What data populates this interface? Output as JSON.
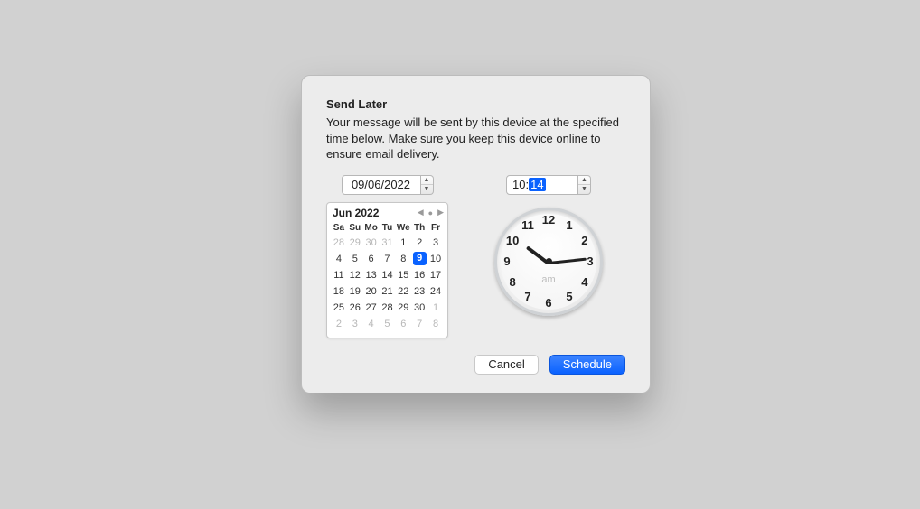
{
  "dialog": {
    "title": "Send Later",
    "description": "Your message will be sent by this device at the specified time below. Make sure you keep this device online to ensure email delivery.",
    "date_value": "09/06/2022",
    "time_hour": "10",
    "time_sep": ":",
    "time_min": "14",
    "calendar": {
      "month_label": "Jun 2022",
      "dow": [
        "Sa",
        "Su",
        "Mo",
        "Tu",
        "We",
        "Th",
        "Fr"
      ],
      "rows": [
        [
          {
            "v": "28",
            "dim": true
          },
          {
            "v": "29",
            "dim": true
          },
          {
            "v": "30",
            "dim": true
          },
          {
            "v": "31",
            "dim": true
          },
          {
            "v": "1"
          },
          {
            "v": "2"
          },
          {
            "v": "3"
          }
        ],
        [
          {
            "v": "4"
          },
          {
            "v": "5"
          },
          {
            "v": "6"
          },
          {
            "v": "7"
          },
          {
            "v": "8"
          },
          {
            "v": "9",
            "sel": true
          },
          {
            "v": "10"
          }
        ],
        [
          {
            "v": "11"
          },
          {
            "v": "12"
          },
          {
            "v": "13"
          },
          {
            "v": "14"
          },
          {
            "v": "15"
          },
          {
            "v": "16"
          },
          {
            "v": "17"
          }
        ],
        [
          {
            "v": "18"
          },
          {
            "v": "19"
          },
          {
            "v": "20"
          },
          {
            "v": "21"
          },
          {
            "v": "22"
          },
          {
            "v": "23"
          },
          {
            "v": "24"
          }
        ],
        [
          {
            "v": "25"
          },
          {
            "v": "26"
          },
          {
            "v": "27"
          },
          {
            "v": "28"
          },
          {
            "v": "29"
          },
          {
            "v": "30"
          },
          {
            "v": "1",
            "dim": true
          }
        ],
        [
          {
            "v": "2",
            "dim": true
          },
          {
            "v": "3",
            "dim": true
          },
          {
            "v": "4",
            "dim": true
          },
          {
            "v": "5",
            "dim": true
          },
          {
            "v": "6",
            "dim": true
          },
          {
            "v": "7",
            "dim": true
          },
          {
            "v": "8",
            "dim": true
          }
        ]
      ]
    },
    "clock": {
      "ampm": "am",
      "hour_angle": 307,
      "minute_angle": 84,
      "numerals": [
        "12",
        "1",
        "2",
        "3",
        "4",
        "5",
        "6",
        "7",
        "8",
        "9",
        "10",
        "11"
      ]
    },
    "buttons": {
      "cancel": "Cancel",
      "schedule": "Schedule"
    }
  }
}
